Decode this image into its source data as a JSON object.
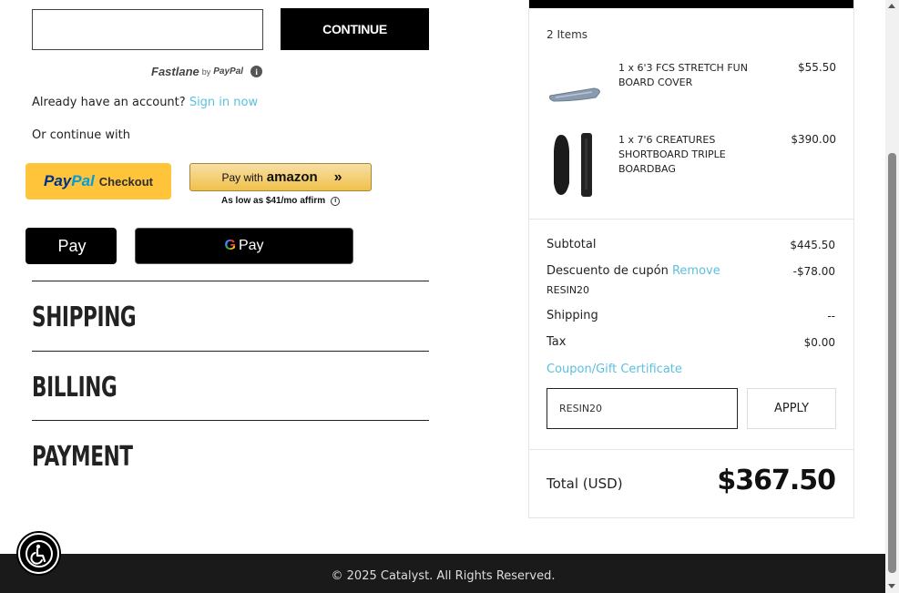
{
  "checkout": {
    "email_value": "",
    "continue_label": "CONTINUE",
    "fastlane": {
      "name": "Fastlane",
      "by": "by",
      "paypal": "PayPal"
    },
    "account_prompt": "Already have an account?",
    "sign_in_label": "Sign in now",
    "or_continue": "Or continue with",
    "paypal": {
      "logo_pay": "Pay",
      "logo_pal": "Pal",
      "label": "Checkout"
    },
    "amazon": {
      "pay_with": "Pay with",
      "logo": "amazon",
      "arrow": "»"
    },
    "affirm": {
      "text": "As low as $41/mo",
      "brand": "affirm",
      "info": "i"
    },
    "applepay": {
      "logo": "",
      "label": "Pay"
    },
    "googlepay": {
      "g": "G",
      "label": "Pay"
    },
    "sections": [
      "SHIPPING",
      "BILLING",
      "PAYMENT"
    ]
  },
  "summary": {
    "items_count": "2 Items",
    "items": [
      {
        "name": "1 x 6'3 FCS STRETCH FUN BOARD COVER",
        "price": "$55.50",
        "thumb": "board-cover"
      },
      {
        "name": "1 x 7'6 CREATURES SHORTBOARD TRIPLE BOARDBAG",
        "price": "$390.00",
        "thumb": "boardbag"
      }
    ],
    "subtotal_label": "Subtotal",
    "subtotal_value": "$445.50",
    "discount_label": "Descuento de cupón",
    "discount_remove": "Remove",
    "discount_code": "RESIN20",
    "discount_value": "-$78.00",
    "shipping_label": "Shipping",
    "shipping_value": "--",
    "tax_label": "Tax",
    "tax_value": "$0.00",
    "coupon_link": "Coupon/Gift Certificate",
    "coupon_input_value": "RESIN20",
    "apply_label": "APPLY",
    "total_label": "Total (USD)",
    "total_value": "$367.50"
  },
  "footer": {
    "copyright": "© 2025 Catalyst. All Rights Reserved."
  },
  "colors": {
    "link": "#5bc0de",
    "paypal_yellow": "#ffc439",
    "black": "#000000"
  }
}
